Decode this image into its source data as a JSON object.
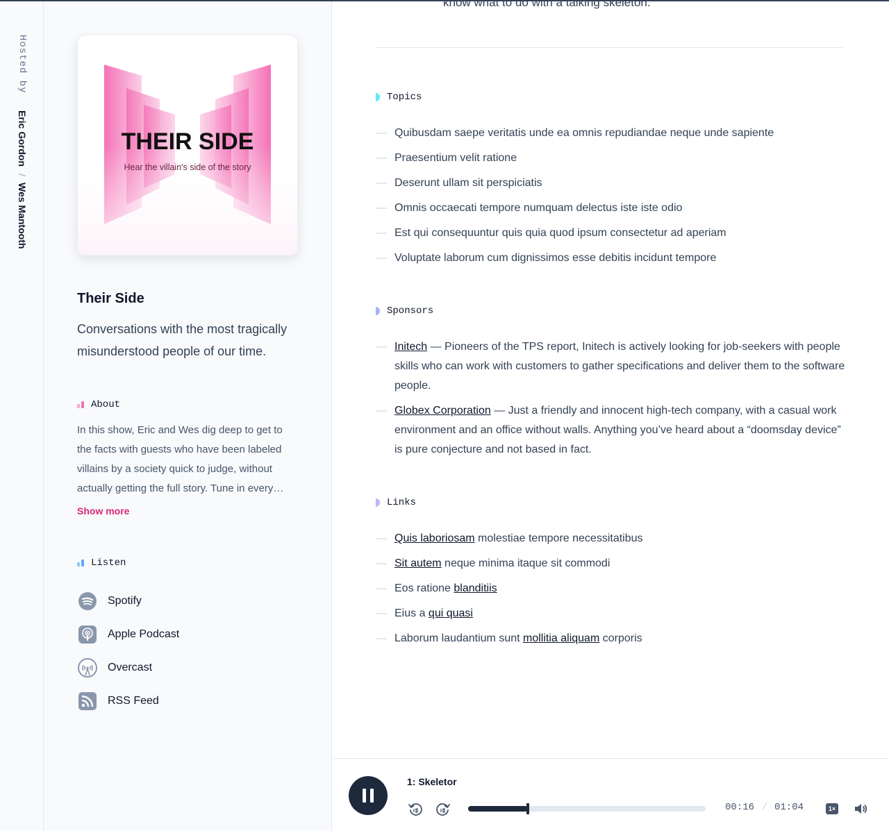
{
  "hosts": {
    "label": "Hosted by",
    "names": [
      "Eric Gordon",
      "Wes Mantooth"
    ],
    "separator": "/"
  },
  "cover": {
    "title": "THEIR SIDE",
    "tagline": "Hear the villain's side of the story",
    "accent": "#ec4899"
  },
  "show": {
    "title": "Their Side",
    "description": "Conversations with the most tragically misunderstood people of our time."
  },
  "about": {
    "heading": "About",
    "text": "In this show, Eric and Wes dig deep to get to the facts with guests who have been labeled villains by a society quick to judge, without actually getting the full story. Tune in every…",
    "show_more": "Show more"
  },
  "listen": {
    "heading": "Listen",
    "items": [
      {
        "label": "Spotify",
        "icon": "spotify-icon"
      },
      {
        "label": "Apple Podcast",
        "icon": "apple-podcast-icon"
      },
      {
        "label": "Overcast",
        "icon": "overcast-icon"
      },
      {
        "label": "RSS Feed",
        "icon": "rss-icon"
      }
    ]
  },
  "main": {
    "top_text": "know what to do with a talking skeleton.",
    "topics": {
      "heading": "Topics",
      "items": [
        "Quibusdam saepe veritatis unde ea omnis repudiandae neque unde sapiente",
        "Praesentium velit ratione",
        "Deserunt ullam sit perspiciatis",
        "Omnis occaecati tempore numquam delectus iste iste odio",
        "Est qui consequuntur quis quia quod ipsum consectetur ad aperiam",
        "Voluptate laborum cum dignissimos esse debitis incidunt tempore"
      ]
    },
    "sponsors": {
      "heading": "Sponsors",
      "items": [
        {
          "name": "Initech",
          "text": " — Pioneers of the TPS report, Initech is actively looking for job-seekers with people skills who can work with customers to gather specifications and deliver them to the software people."
        },
        {
          "name": "Globex Corporation",
          "text": " — Just a friendly and innocent high-tech company, with a casual work environment and an office without walls. Anything you’ve heard about a “doomsday device” is pure conjecture and not based in fact."
        }
      ]
    },
    "links": {
      "heading": "Links",
      "items": [
        {
          "before": "",
          "link": "Quis laboriosam",
          "after": " molestiae tempore necessitatibus"
        },
        {
          "before": "",
          "link": "Sit autem",
          "after": " neque minima itaque sit commodi"
        },
        {
          "before": "Eos ratione ",
          "link": "blanditiis",
          "after": ""
        },
        {
          "before": "Eius a ",
          "link": "qui quasi",
          "after": ""
        },
        {
          "before": "Laborum laudantium sunt ",
          "link": "mollitia aliquam",
          "after": " corporis"
        }
      ]
    }
  },
  "player": {
    "episode_title": "1: Skeletor",
    "current_time": "00:16",
    "separator": "/",
    "duration": "01:04",
    "progress": 0.25,
    "rate_label": "1×",
    "state": "playing"
  }
}
